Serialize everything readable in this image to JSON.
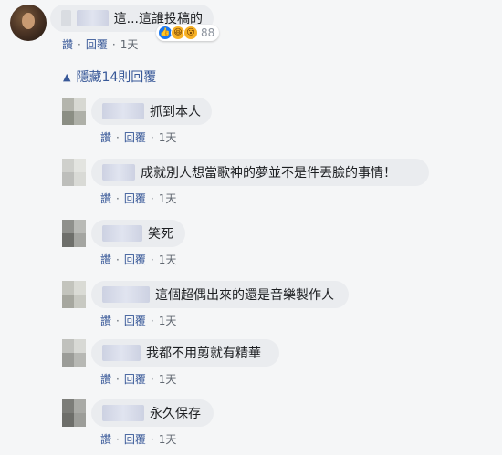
{
  "top_comment": {
    "text": "這...這誰投稿的",
    "reaction_count": "88",
    "actions": {
      "like": "讚",
      "reply": "回覆",
      "time": "1天"
    }
  },
  "hidden_replies_label": "隱藏14則回覆",
  "replies": [
    {
      "text": "抓到本人",
      "actions": {
        "like": "讚",
        "reply": "回覆",
        "time": "1天"
      }
    },
    {
      "text": "成就別人想當歌神的夢並不是件丟臉的事情！",
      "actions": {
        "like": "讚",
        "reply": "回覆",
        "time": "1天"
      }
    },
    {
      "text": "笑死",
      "actions": {
        "like": "讚",
        "reply": "回覆",
        "time": "1天"
      }
    },
    {
      "text": "這個超偶出來的還是音樂製作人",
      "actions": {
        "like": "讚",
        "reply": "回覆",
        "time": "1天"
      }
    },
    {
      "text": "我都不用剪就有精華",
      "actions": {
        "like": "讚",
        "reply": "回覆",
        "time": "1天"
      }
    },
    {
      "text": "永久保存",
      "actions": {
        "like": "讚",
        "reply": "回覆",
        "time": "1天"
      }
    }
  ],
  "colors": {
    "link": "#385898",
    "bubble": "#eaecef",
    "background": "#f5f6f7",
    "like_reaction": "#1877f2",
    "emoji_reaction": "#f7b125"
  }
}
